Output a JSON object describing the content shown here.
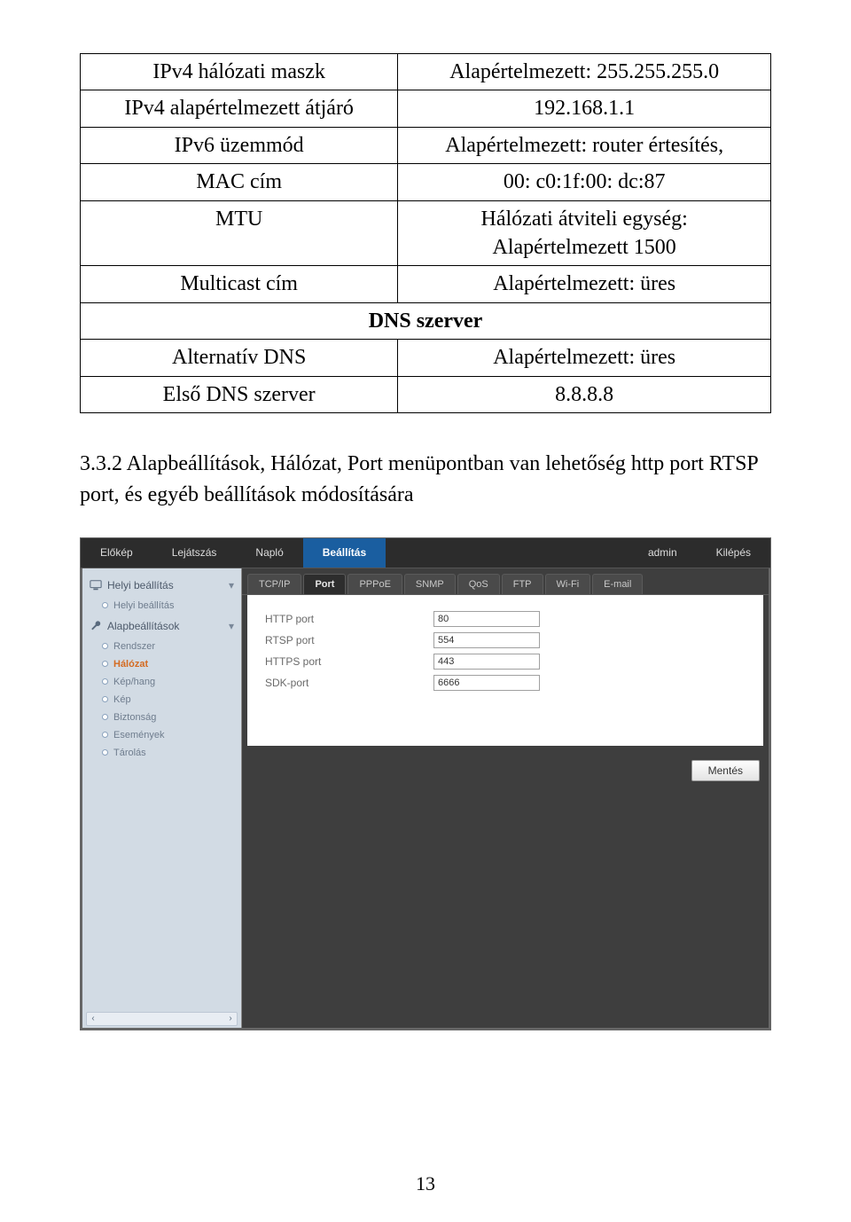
{
  "table": {
    "rows": [
      {
        "left": "IPv4 hálózati maszk",
        "right": "Alapértelmezett: 255.255.255.0"
      },
      {
        "left": "IPv4 alapértelmezett átjáró",
        "right": "192.168.1.1"
      },
      {
        "left": "IPv6 üzemmód",
        "right": "Alapértelmezett: router értesítés,"
      },
      {
        "left": "MAC cím",
        "right": "00: c0:1f:00: dc:87"
      },
      {
        "left": "MTU",
        "right": "Hálózati átviteli egység:\nAlapértelmezett 1500"
      },
      {
        "left": "Multicast cím",
        "right": "Alapértelmezett: üres"
      }
    ],
    "dns_header": "DNS szerver",
    "dns_rows": [
      {
        "left": "Alternatív DNS",
        "right": "Alapértelmezett: üres"
      },
      {
        "left": "Első DNS szerver",
        "right": "8.8.8.8"
      }
    ]
  },
  "section_text": "3.3.2 Alapbeállítások, Hálózat, Port menüpontban van lehetőség http port RTSP port, és egyéb beállítások módosítására",
  "app": {
    "topbar": {
      "items": [
        "Előkép",
        "Lejátszás",
        "Napló",
        "Beállítás"
      ],
      "active_index": 3,
      "user": "admin",
      "logout": "Kilépés"
    },
    "sidebar": {
      "group1": "Helyi beállítás",
      "group1_sub": "Helyi beállítás",
      "group2": "Alapbeállítások",
      "subs": [
        "Rendszer",
        "Hálózat",
        "Kép/hang",
        "Kép",
        "Biztonság",
        "Események",
        "Tárolás"
      ],
      "active_sub_index": 1
    },
    "tabs": {
      "items": [
        "TCP/IP",
        "Port",
        "PPPoE",
        "SNMP",
        "QoS",
        "FTP",
        "Wi-Fi",
        "E-mail"
      ],
      "active_index": 1
    },
    "form": {
      "rows": [
        {
          "label": "HTTP port",
          "value": "80"
        },
        {
          "label": "RTSP port",
          "value": "554"
        },
        {
          "label": "HTTPS port",
          "value": "443"
        },
        {
          "label": "SDK-port",
          "value": "6666"
        }
      ]
    },
    "save_button": "Mentés"
  },
  "page_number": "13"
}
